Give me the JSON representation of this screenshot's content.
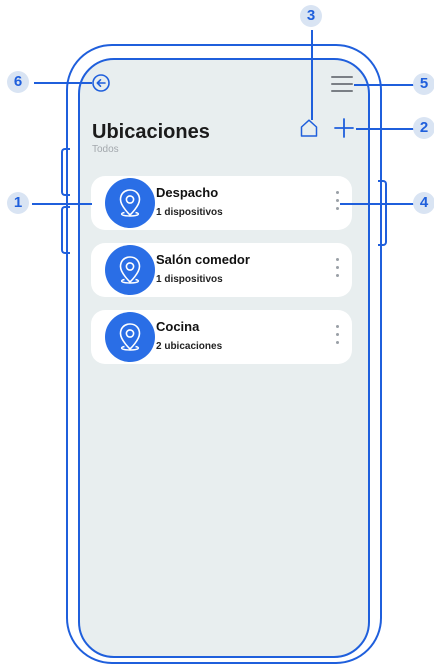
{
  "header": {
    "title": "Ubicaciones",
    "subtitle": "Todos"
  },
  "locations": [
    {
      "name": "Despacho",
      "detail": "1 dispositivos"
    },
    {
      "name": "Salón comedor",
      "detail": "1 dispositivos"
    },
    {
      "name": "Cocina",
      "detail": "2 ubicaciones"
    }
  ],
  "callouts": {
    "c1": "1",
    "c2": "2",
    "c3": "3",
    "c4": "4",
    "c5": "5",
    "c6": "6"
  },
  "icons": {
    "back": "back-arrow-circle-icon",
    "menu": "hamburger-menu-icon",
    "home": "home-icon",
    "add": "plus-icon",
    "location": "location-pin-icon",
    "more": "more-vertical-icon"
  },
  "colors": {
    "accent": "#1f5fdc",
    "card_icon_bg": "#2a6ee6",
    "screen_bg": "#e8eeef"
  }
}
